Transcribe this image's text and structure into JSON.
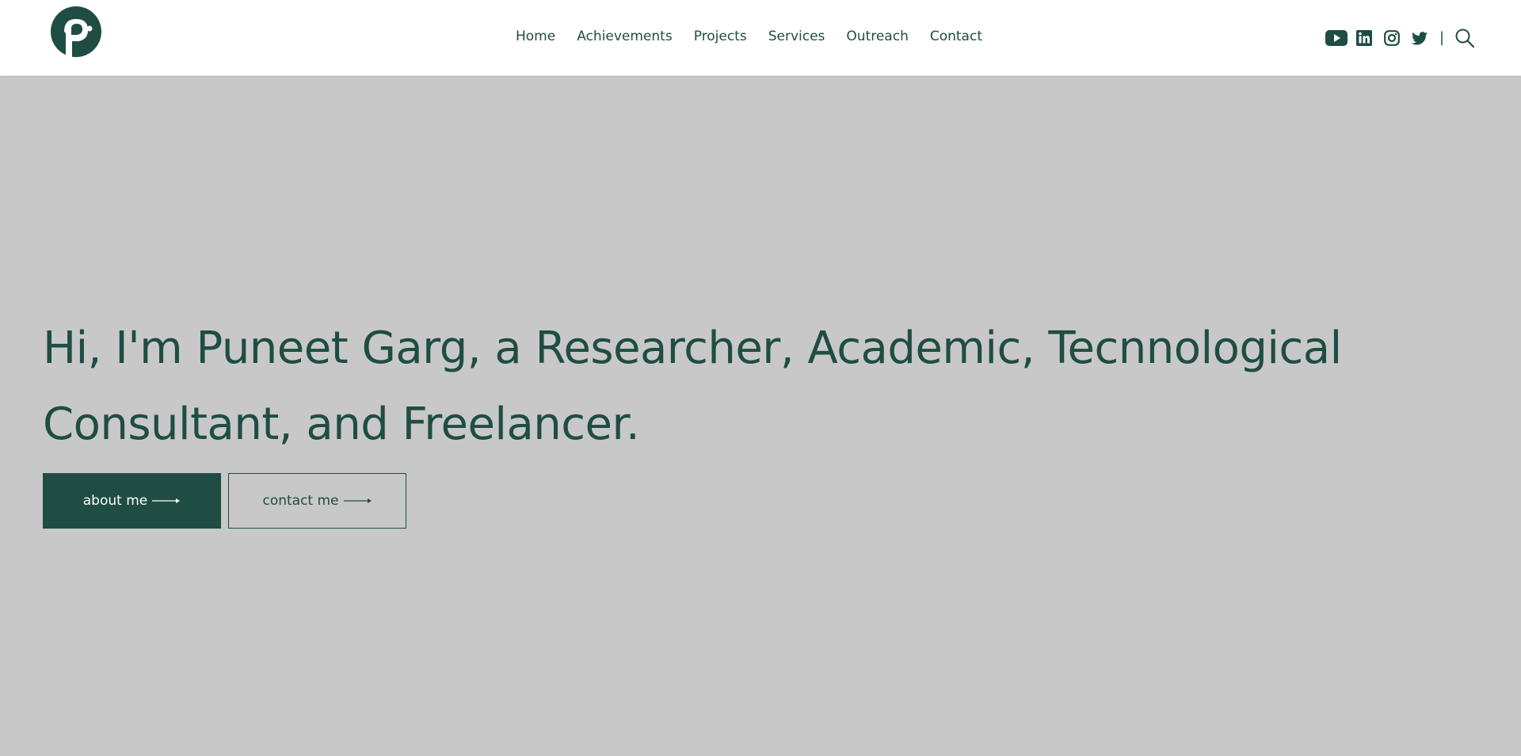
{
  "header": {
    "logo_name": "pg-logo",
    "nav": [
      {
        "label": "Home"
      },
      {
        "label": "Achievements"
      },
      {
        "label": "Projects"
      },
      {
        "label": "Services"
      },
      {
        "label": "Outreach"
      },
      {
        "label": "Contact"
      }
    ],
    "social": {
      "icons": [
        "youtube-icon",
        "linkedin-icon",
        "instagram-icon",
        "twitter-icon",
        "search-icon"
      ],
      "separator": "|"
    }
  },
  "hero": {
    "title": "Hi, I'm Puneet Garg, a Researcher, Academic, Tecnnological Consultant, and Freelancer.",
    "buttons": {
      "about": "about me",
      "contact": "contact me"
    }
  },
  "colors": {
    "accent": "#1f4d43",
    "background": "#c8c8c8",
    "header": "#ffffff"
  }
}
